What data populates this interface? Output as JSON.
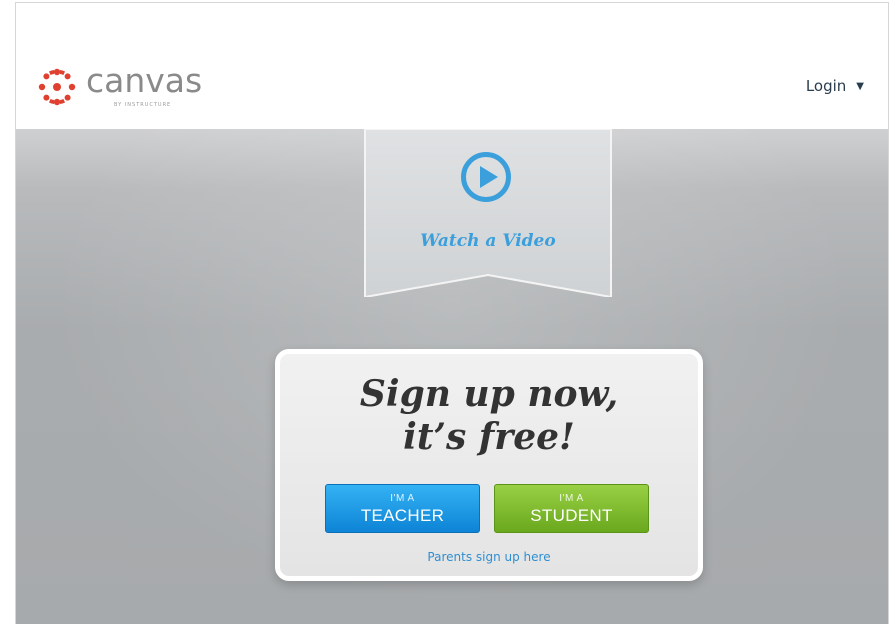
{
  "header": {
    "logo_text": "canvas",
    "logo_subtext": "BY INSTRUCTURE",
    "login_label": "Login",
    "login_caret": "▼"
  },
  "hero": {
    "video_label": "Watch a Video",
    "headline_line1": "Sign up now,",
    "headline_line2": "it’s free!",
    "teacher_button": {
      "small": "I'M A",
      "big": "TEACHER"
    },
    "student_button": {
      "small": "I'M A",
      "big": "STUDENT"
    },
    "parents_link": "Parents sign up here"
  },
  "colors": {
    "brand_red": "#e0402f",
    "video_blue": "#3b9fdc",
    "teacher_blue": "#1a9be6",
    "student_green": "#7fbf2f",
    "link_blue": "#2f8fd0"
  },
  "icons": {
    "logo_mark": "canvas-dots-circle-icon",
    "play": "play-circle-icon",
    "caret": "caret-down-icon"
  }
}
